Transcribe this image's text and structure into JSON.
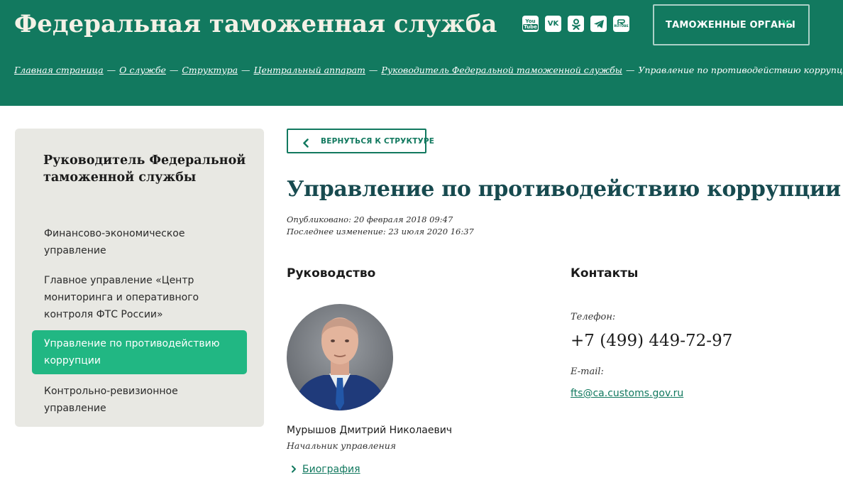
{
  "header": {
    "site_title": "Федеральная таможенная служба",
    "socials": [
      "YouTube",
      "VK",
      "Одноклассники",
      "Telegram",
      "RUTUBE"
    ],
    "organs_button": "ТАМОЖЕННЫЕ ОРГАНЫ",
    "breadcrumbs": [
      "Главная страница",
      "О службе",
      "Структура",
      "Центральный аппарат",
      "Руководитель Федеральной таможенной службы",
      "Управление по противодействию коррупции"
    ],
    "breadcrumb_separator": "—"
  },
  "sidebar": {
    "title": "Руководитель Федеральной таможенной службы",
    "items": [
      {
        "label": "Финансово-экономическое управление",
        "active": false
      },
      {
        "label": "Главное управление «Центр мониторинга и оперативного контроля ФТС России»",
        "active": false
      },
      {
        "label": "Управление по противодействию коррупции",
        "active": true
      },
      {
        "label": "Контрольно-ревизионное управление",
        "active": false
      }
    ]
  },
  "main": {
    "back_button": "ВЕРНУТЬСЯ К СТРУКТУРЕ",
    "title": "Управление по противодействию коррупции",
    "published": "Опубликовано: 20 февраля 2018 09:47",
    "modified": "Последнее изменение: 23 июля 2020 16:37",
    "leadership": {
      "heading": "Руководство",
      "name": "Мурышов Дмитрий Николаевич",
      "position": "Начальник управления",
      "bio_link": "Биография"
    },
    "contacts": {
      "heading": "Контакты",
      "phone_label": "Телефон:",
      "phone": "+7 (499) 449-72-97",
      "email_label": "E-mail:",
      "email": "fts@ca.customs.gov.ru"
    }
  },
  "colors": {
    "header_bg": "#12795f",
    "accent": "#21b783",
    "title": "#174a4f",
    "sidebar_bg": "#e8e8e3"
  }
}
